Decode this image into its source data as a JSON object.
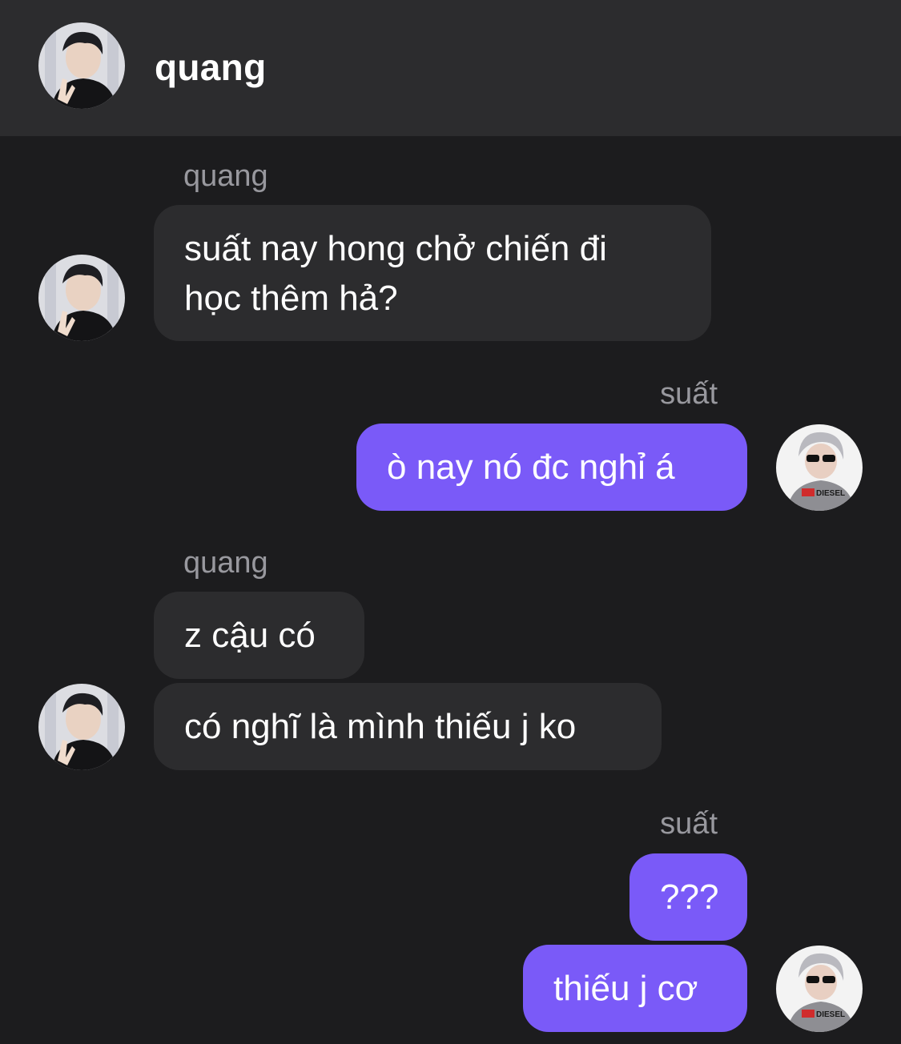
{
  "header": {
    "title": "quang",
    "avatar_icon": "contact-avatar-photo"
  },
  "colors": {
    "background": "#1c1c1e",
    "header_background": "#2c2c2e",
    "incoming_bubble": "#2c2c2e",
    "outgoing_bubble": "#7a5af8",
    "sender_label": "#98989e"
  },
  "messages": [
    {
      "group": 1,
      "direction": "incoming",
      "sender": "quang",
      "bubbles": [
        {
          "lines": [
            "suất nay hong chở chiến đi",
            "học thêm hả?"
          ]
        }
      ]
    },
    {
      "group": 2,
      "direction": "outgoing",
      "sender": "suất",
      "bubbles": [
        {
          "text": "ò nay nó đc nghỉ á"
        }
      ]
    },
    {
      "group": 3,
      "direction": "incoming",
      "sender": "quang",
      "bubbles": [
        {
          "text": "z cậu có"
        },
        {
          "text": "có nghĩ là mình thiếu j ko"
        }
      ]
    },
    {
      "group": 4,
      "direction": "outgoing",
      "sender": "suất",
      "bubbles": [
        {
          "text": "???"
        },
        {
          "text": "thiếu j cơ"
        }
      ]
    }
  ],
  "avatars": {
    "quang_icon": "quang-avatar-photo",
    "suat_icon": "suat-avatar-photo",
    "suat_shirt_text": "DIESEL"
  }
}
